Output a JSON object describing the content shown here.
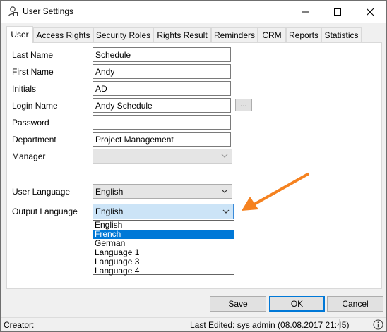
{
  "window": {
    "title": "User Settings",
    "app_icon": "user-settings-icon",
    "controls": {
      "minimize": "minimize-icon",
      "maximize": "maximize-icon",
      "close": "close-icon"
    }
  },
  "tabs": [
    {
      "label": "User",
      "active": true
    },
    {
      "label": "Access Rights"
    },
    {
      "label": "Security Roles"
    },
    {
      "label": "Rights Result"
    },
    {
      "label": "Reminders"
    },
    {
      "label": "CRM"
    },
    {
      "label": "Reports"
    },
    {
      "label": "Statistics"
    }
  ],
  "form": {
    "last_name": {
      "label": "Last Name",
      "value": "Schedule"
    },
    "first_name": {
      "label": "First Name",
      "value": "Andy"
    },
    "initials": {
      "label": "Initials",
      "value": "AD"
    },
    "login_name": {
      "label": "Login Name",
      "value": "Andy Schedule",
      "browse_label": "..."
    },
    "password": {
      "label": "Password",
      "value": ""
    },
    "department": {
      "label": "Department",
      "value": "Project Management"
    },
    "manager": {
      "label": "Manager",
      "value": ""
    },
    "user_language": {
      "label": "User Language",
      "value": "English"
    },
    "output_language": {
      "label": "Output Language",
      "value": "English",
      "options": [
        "English",
        "French",
        "German",
        "Language 1",
        "Language 3",
        "Language 4"
      ],
      "highlighted": "French"
    }
  },
  "annotation": {
    "color": "#f58220"
  },
  "buttons": {
    "save": "Save",
    "ok": "OK",
    "cancel": "Cancel"
  },
  "status": {
    "creator": "Creator:",
    "last_edited": "Last Edited:  sys admin (08.08.2017 21:45)",
    "info_icon": "info-icon"
  },
  "colors": {
    "accent": "#0078d7",
    "selection": "#0078d7",
    "open_combo": "#cce4f7"
  }
}
